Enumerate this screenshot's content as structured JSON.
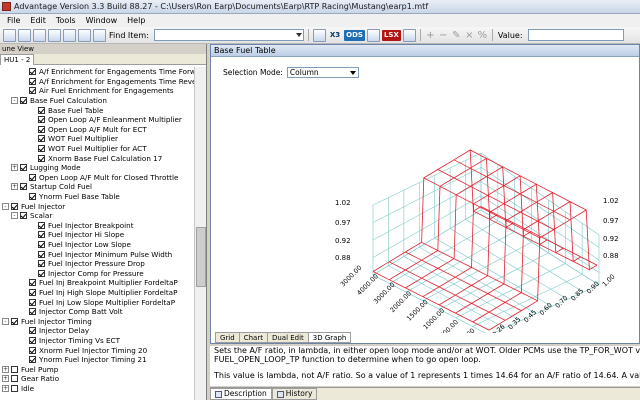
{
  "window": {
    "title": "Advantage Version 3.3 Build 88.27 - C:\\Users\\Ron Earp\\Documents\\Earp\\RTP Racing\\Mustang\\earp1.mtf"
  },
  "menu": [
    "File",
    "Edit",
    "Tools",
    "Window",
    "Help"
  ],
  "toolbar": {
    "find_label": "Find Item:",
    "value_label": "Value:",
    "badges": [
      "X3",
      "ODS",
      "LSX"
    ]
  },
  "left_panel": {
    "header": "une View",
    "tab": "HU1 - 2",
    "tree": [
      {
        "label": "A/f Enrichment for Engagements Time Forward",
        "indent": 2,
        "expander": "",
        "checked": true
      },
      {
        "label": "A/f Enrichment for Engagements Time Reverse",
        "indent": 2,
        "expander": "",
        "checked": true
      },
      {
        "label": "Air Fuel Enrichment for Engagements",
        "indent": 2,
        "expander": "",
        "checked": true
      },
      {
        "label": "Base Fuel Calculation",
        "indent": 1,
        "expander": "-",
        "checked": true
      },
      {
        "label": "Base Fuel Table",
        "indent": 3,
        "expander": "",
        "checked": true
      },
      {
        "label": "Open Loop A/F Enleanment Multiplier",
        "indent": 3,
        "expander": "",
        "checked": true
      },
      {
        "label": "Open Loop A/F Mult for ECT",
        "indent": 3,
        "expander": "",
        "checked": true
      },
      {
        "label": "WOT Fuel Multiplier",
        "indent": 3,
        "expander": "",
        "checked": true
      },
      {
        "label": "WOT Fuel Multiplier for ACT",
        "indent": 3,
        "expander": "",
        "checked": true
      },
      {
        "label": "Xnorm Base Fuel Calculation 17",
        "indent": 3,
        "expander": "",
        "checked": true
      },
      {
        "label": "Lugging Mode",
        "indent": 1,
        "expander": "+",
        "checked": true
      },
      {
        "label": "Open Loop A/F Mult for Closed Throttle",
        "indent": 2,
        "expander": "",
        "checked": true
      },
      {
        "label": "Startup Cold Fuel",
        "indent": 1,
        "expander": "+",
        "checked": true
      },
      {
        "label": "Ynorm Fuel Base Table",
        "indent": 2,
        "expander": "",
        "checked": true
      },
      {
        "label": "Fuel Injector",
        "indent": 0,
        "expander": "-",
        "checked": true
      },
      {
        "label": "Scalar",
        "indent": 1,
        "expander": "-",
        "checked": true
      },
      {
        "label": "Fuel Injector Breakpoint",
        "indent": 3,
        "expander": "",
        "checked": true
      },
      {
        "label": "Fuel Injector Hi Slope",
        "indent": 3,
        "expander": "",
        "checked": true
      },
      {
        "label": "Fuel Injector Low Slope",
        "indent": 3,
        "expander": "",
        "checked": true
      },
      {
        "label": "Fuel Injector Minimum Pulse Width",
        "indent": 3,
        "expander": "",
        "checked": true
      },
      {
        "label": "Fuel Injector Pressure Drop",
        "indent": 3,
        "expander": "",
        "checked": true
      },
      {
        "label": "Injector Comp for Pressure",
        "indent": 3,
        "expander": "",
        "checked": true
      },
      {
        "label": "Fuel Inj Breakpoint Multiplier FordeltaP",
        "indent": 2,
        "expander": "",
        "checked": true
      },
      {
        "label": "Fuel Inj High Slope Multiplier FordeltaP",
        "indent": 2,
        "expander": "",
        "checked": true
      },
      {
        "label": "Fuel Inj Low Slope Multiplier FordeltaP",
        "indent": 2,
        "expander": "",
        "checked": true
      },
      {
        "label": "Injector Comp Batt Volt",
        "indent": 2,
        "expander": "",
        "checked": true
      },
      {
        "label": "Fuel Injector Timing",
        "indent": 0,
        "expander": "-",
        "checked": true
      },
      {
        "label": "Injector Delay",
        "indent": 2,
        "expander": "",
        "checked": true
      },
      {
        "label": "Injector Timing Vs ECT",
        "indent": 2,
        "expander": "",
        "checked": true
      },
      {
        "label": "Xnorm Fuel Injector Timing 20",
        "indent": 2,
        "expander": "",
        "checked": true
      },
      {
        "label": "Ynorm Fuel Injector Timing 21",
        "indent": 2,
        "expander": "",
        "checked": true
      },
      {
        "label": "Fuel Pump",
        "indent": 0,
        "expander": "+",
        "checked": false
      },
      {
        "label": "Gear Ratio",
        "indent": 0,
        "expander": "+",
        "checked": false
      },
      {
        "label": "Idle",
        "indent": 0,
        "expander": "+",
        "checked": false
      }
    ]
  },
  "doc": {
    "title": "Base Fuel Table",
    "selection_mode_label": "Selection Mode:",
    "selection_mode_value": "Column",
    "tabs": [
      "Grid",
      "Chart",
      "Dual Edit",
      "3D Graph"
    ],
    "active_tab": "3D Graph"
  },
  "chart_data": {
    "type": "surface",
    "z_ticks": [
      "1.02",
      "0.97",
      "0.92",
      "0.88"
    ],
    "y_ticks": [
      "3000.00",
      "4000.00",
      "3000.00",
      "2000.00",
      "1500.00",
      "1000.00",
      "700.00",
      "500.00"
    ],
    "x_ticks": [
      "0.26",
      "0.35",
      "0.45",
      "0.60",
      "0.70",
      "0.85",
      "0.90",
      "1.00"
    ],
    "grid": true,
    "series_color": "#e0202e",
    "grid_color": "#7ec9c9"
  },
  "description": {
    "lines": [
      "Sets the A/F ratio, in lambda, in either open loop mode and/or at WOT. Older PCMs use the TP_FOR_WOT value, while",
      "FUEL_OPEN_LOOP_TP function to determine when to go open loop.",
      "This value is lambda, not A/F ratio. So a value of 1 represents 1 times 14.64 for an A/F ratio of 14.64. A value of 0.82 mea"
    ]
  },
  "bottom_tabs": [
    "Description",
    "History"
  ]
}
